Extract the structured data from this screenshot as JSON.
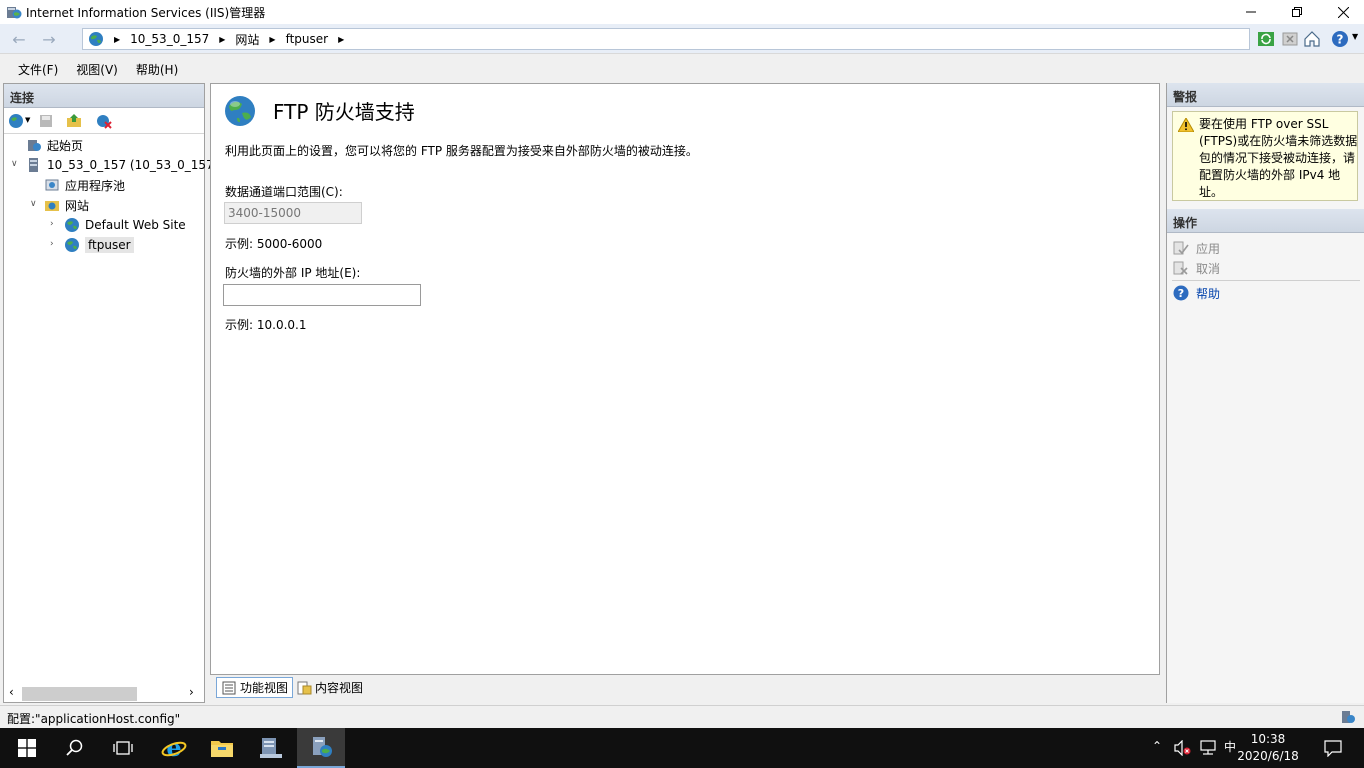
{
  "window": {
    "title": "Internet Information Services (IIS)管理器",
    "minimize_icon": "minimize-icon",
    "restore_icon": "restore-icon",
    "close_icon": "close-icon"
  },
  "address": {
    "breadcrumbs": [
      "10_53_0_157",
      "网站",
      "ftpuser"
    ]
  },
  "menu": {
    "items": [
      "文件(F)",
      "视图(V)",
      "帮助(H)"
    ]
  },
  "connections": {
    "header": "连接",
    "tree": [
      {
        "label": "起始页"
      },
      {
        "label": "10_53_0_157 (10_53_0_157\\"
      },
      {
        "label": "应用程序池"
      },
      {
        "label": "网站"
      },
      {
        "label": "Default Web Site"
      },
      {
        "label": "ftpuser"
      }
    ]
  },
  "main": {
    "heading": "FTP 防火墙支持",
    "description": "利用此页面上的设置，您可以将您的 FTP 服务器配置为接受来自外部防火墙的被动连接。",
    "port_label": "数据通道端口范围(C):",
    "port_value": "3400-15000",
    "port_example": "示例: 5000-6000",
    "ip_label": "防火墙的外部 IP 地址(E):",
    "ip_value": "",
    "ip_example": "示例: 10.0.0.1"
  },
  "view_tabs": [
    "功能视图",
    "内容视图"
  ],
  "alerts": {
    "header": "警报",
    "message": "要在使用 FTP over SSL (FTPS)或在防火墙未筛选数据包的情况下接受被动连接，请配置防火墙的外部 IPv4 地址。"
  },
  "actions": {
    "header": "操作",
    "apply": "应用",
    "cancel": "取消",
    "help": "帮助"
  },
  "status": {
    "text": "配置:\"applicationHost.config\""
  },
  "taskbar": {
    "ime": "中",
    "time": "10:38",
    "date": "2020/6/18"
  }
}
